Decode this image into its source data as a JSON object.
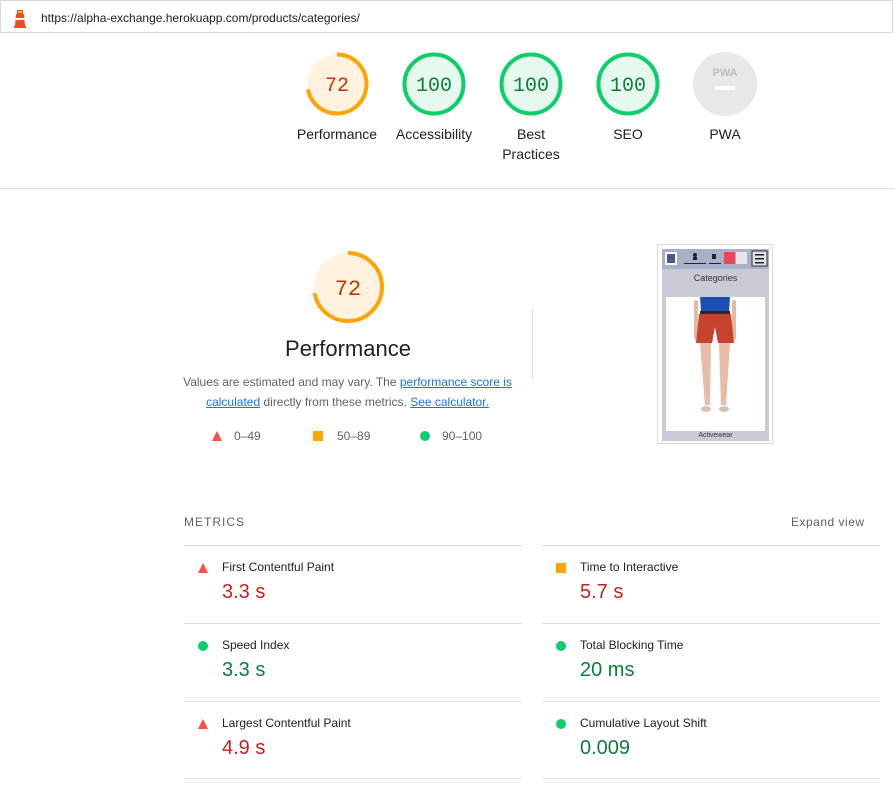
{
  "topbar": {
    "url": "https://alpha-exchange.herokuapp.com/products/categories/"
  },
  "gauges": [
    {
      "score": "72",
      "label": "Performance",
      "rating": "average",
      "fraction": 0.72
    },
    {
      "score": "100",
      "label": "Accessibility",
      "rating": "pass",
      "fraction": 1.0
    },
    {
      "score": "100",
      "label": "Best Practices",
      "rating": "pass",
      "fraction": 1.0
    },
    {
      "score": "100",
      "label": "SEO",
      "rating": "pass",
      "fraction": 1.0
    },
    {
      "score": "",
      "label": "PWA",
      "rating": "pwa",
      "badge": "PWA"
    }
  ],
  "performance": {
    "score": "72",
    "fraction": 0.72,
    "title": "Performance",
    "desc_prefix": "Values are estimated and may vary. The ",
    "link_score": "performance score is calculated",
    "desc_middle": " directly from these metrics. ",
    "link_calc": "See calculator."
  },
  "legend": {
    "fail": "0–49",
    "average": "50–89",
    "pass": "90–100"
  },
  "screenshot": {
    "heading": "Categories",
    "caption": "Activewear"
  },
  "metrics": {
    "header": "METRICS",
    "expand": "Expand view",
    "items": [
      {
        "name": "First Contentful Paint",
        "value": "3.3 s",
        "rating": "fail"
      },
      {
        "name": "Time to Interactive",
        "value": "5.7 s",
        "rating": "average"
      },
      {
        "name": "Speed Index",
        "value": "3.3 s",
        "rating": "pass"
      },
      {
        "name": "Total Blocking Time",
        "value": "20 ms",
        "rating": "pass"
      },
      {
        "name": "Largest Contentful Paint",
        "value": "4.9 s",
        "rating": "fail"
      },
      {
        "name": "Cumulative Layout Shift",
        "value": "0.009",
        "rating": "pass"
      }
    ]
  },
  "colors": {
    "pass": "#0cce6b",
    "pass_text": "#0d7e3a",
    "pass_bg": "#e6f9ee",
    "average": "#ffa400",
    "average_text": "#c33300",
    "average_bg": "#fff3e0",
    "fail": "#ff4e42",
    "fail_text": "#c5221f",
    "pwa_bg": "#e8e8e8",
    "pwa_text": "#bdbdbd"
  }
}
